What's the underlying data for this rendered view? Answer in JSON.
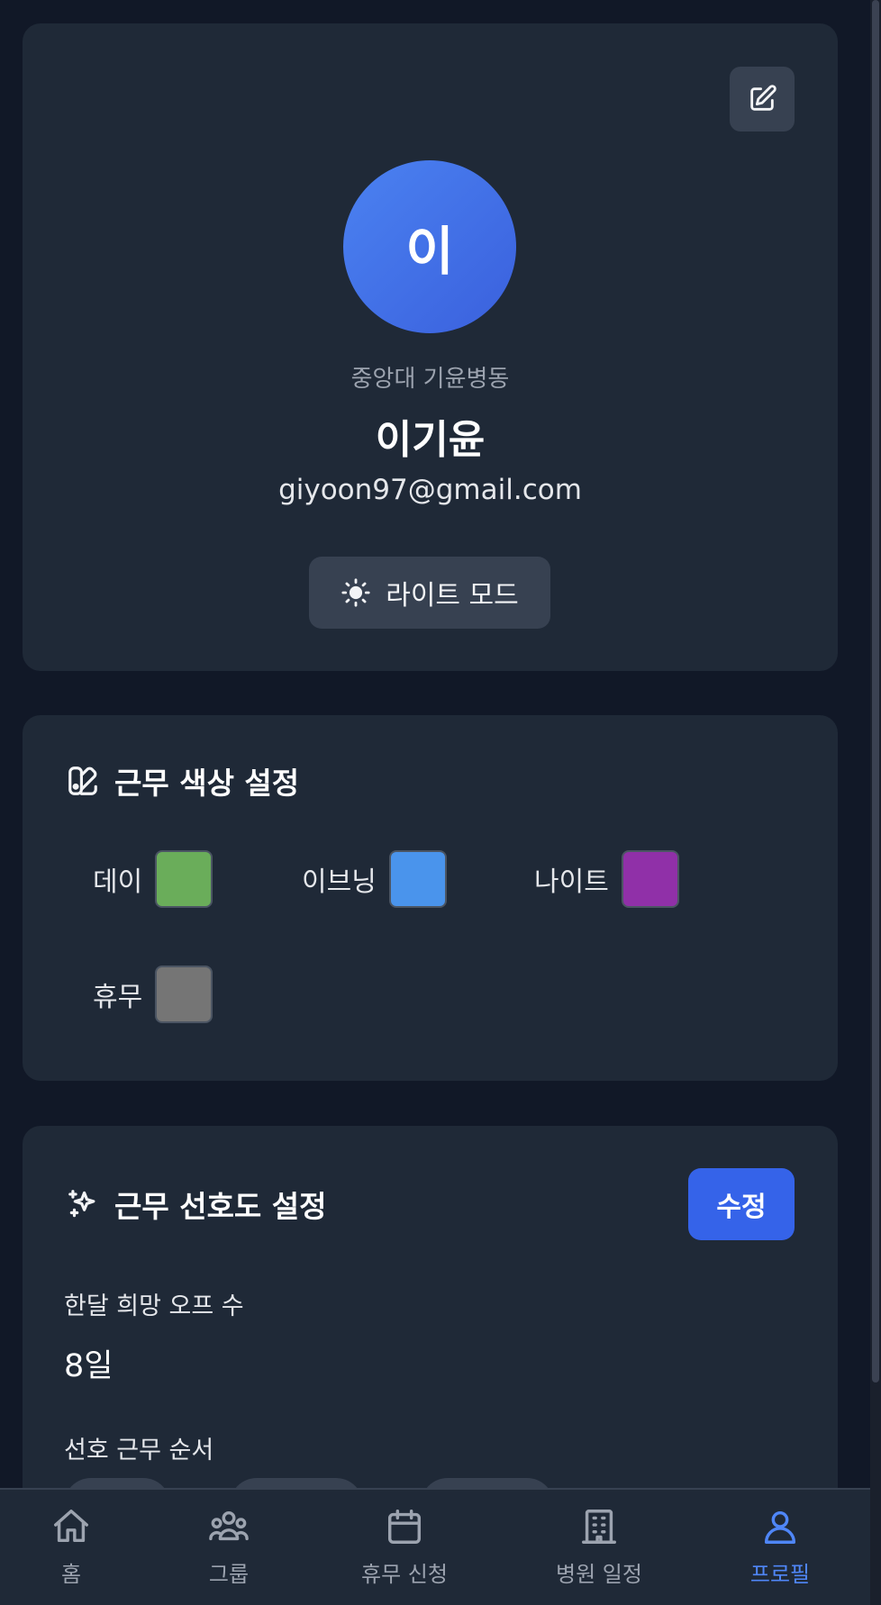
{
  "profile": {
    "avatar_initial": "이",
    "department": "중앙대 기윤병동",
    "name": "이기윤",
    "email": "giyoon97@gmail.com",
    "mode_button_label": "라이트 모드",
    "edit_icon": "pencil-square-icon",
    "mode_icon": "sun-icon"
  },
  "shift_colors": {
    "title": "근무 색상 설정",
    "icon": "palette-icon",
    "items": [
      {
        "label": "데이",
        "color": "#6aad5a"
      },
      {
        "label": "이브닝",
        "color": "#4a94ec"
      },
      {
        "label": "나이트",
        "color": "#9030a8"
      },
      {
        "label": "휴무",
        "color": "#757575"
      }
    ]
  },
  "preferences": {
    "title": "근무 선호도 설정",
    "icon": "sparkles-icon",
    "edit_label": "수정",
    "monthly_off_label": "한달 희망 오프 수",
    "monthly_off_value": "8일",
    "shift_order_label": "선호 근무 순서"
  },
  "nav": {
    "items": [
      {
        "label": "홈",
        "icon": "home-icon",
        "active": false
      },
      {
        "label": "그룹",
        "icon": "users-icon",
        "active": false
      },
      {
        "label": "휴무 신청",
        "icon": "calendar-icon",
        "active": false
      },
      {
        "label": "병원 일정",
        "icon": "building-icon",
        "active": false
      },
      {
        "label": "프로필",
        "icon": "user-icon",
        "active": true
      }
    ]
  },
  "colors": {
    "background": "#111827",
    "card": "#1f2937",
    "accent": "#3563e9",
    "nav_active": "#4f86f7"
  }
}
